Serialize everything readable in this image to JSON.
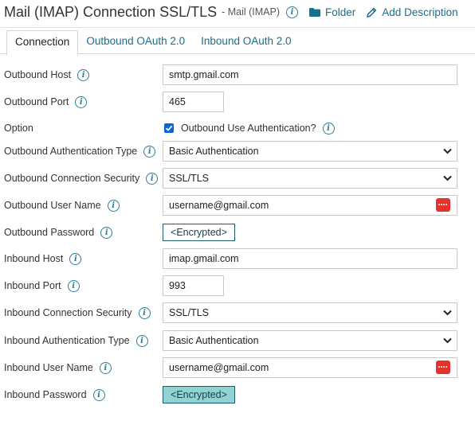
{
  "header": {
    "title": "Mail (IMAP) Connection SSL/TLS",
    "subtitle": "- Mail (IMAP)",
    "folder_label": "Folder",
    "add_description_label": "Add Description"
  },
  "tabs": [
    {
      "label": "Connection",
      "active": true
    },
    {
      "label": "Outbound OAuth 2.0",
      "active": false
    },
    {
      "label": "Inbound OAuth 2.0",
      "active": false
    }
  ],
  "form": {
    "outbound_host": {
      "label": "Outbound Host",
      "value": "smtp.gmail.com"
    },
    "outbound_port": {
      "label": "Outbound Port",
      "value": "465"
    },
    "option": {
      "label": "Option",
      "checkbox_label": "Outbound Use Authentication?",
      "checked": true
    },
    "outbound_auth_type": {
      "label": "Outbound Authentication Type",
      "value": "Basic Authentication"
    },
    "outbound_security": {
      "label": "Outbound Connection Security",
      "value": "SSL/TLS"
    },
    "outbound_user": {
      "label": "Outbound User Name",
      "value": "username@gmail.com"
    },
    "outbound_password": {
      "label": "Outbound Password",
      "value": "<Encrypted>"
    },
    "inbound_host": {
      "label": "Inbound Host",
      "value": "imap.gmail.com"
    },
    "inbound_port": {
      "label": "Inbound Port",
      "value": "993"
    },
    "inbound_security": {
      "label": "Inbound Connection Security",
      "value": "SSL/TLS"
    },
    "inbound_auth_type": {
      "label": "Inbound Authentication Type",
      "value": "Basic Authentication"
    },
    "inbound_user": {
      "label": "Inbound User Name",
      "value": "username@gmail.com"
    },
    "inbound_password": {
      "label": "Inbound Password",
      "value": "<Encrypted>"
    }
  },
  "icons": {
    "info": "info-icon",
    "folder": "folder-icon",
    "pencil": "pencil-icon",
    "chevron": "chevron-down-icon",
    "password_manager": "password-manager-icon",
    "check": "check-icon"
  },
  "colors": {
    "link": "#1a6f8a",
    "info": "#2a7d97",
    "checkbox": "#0b66d9",
    "password_icon": "#e5322d",
    "encrypted_highlight": "#8fd3d3"
  }
}
